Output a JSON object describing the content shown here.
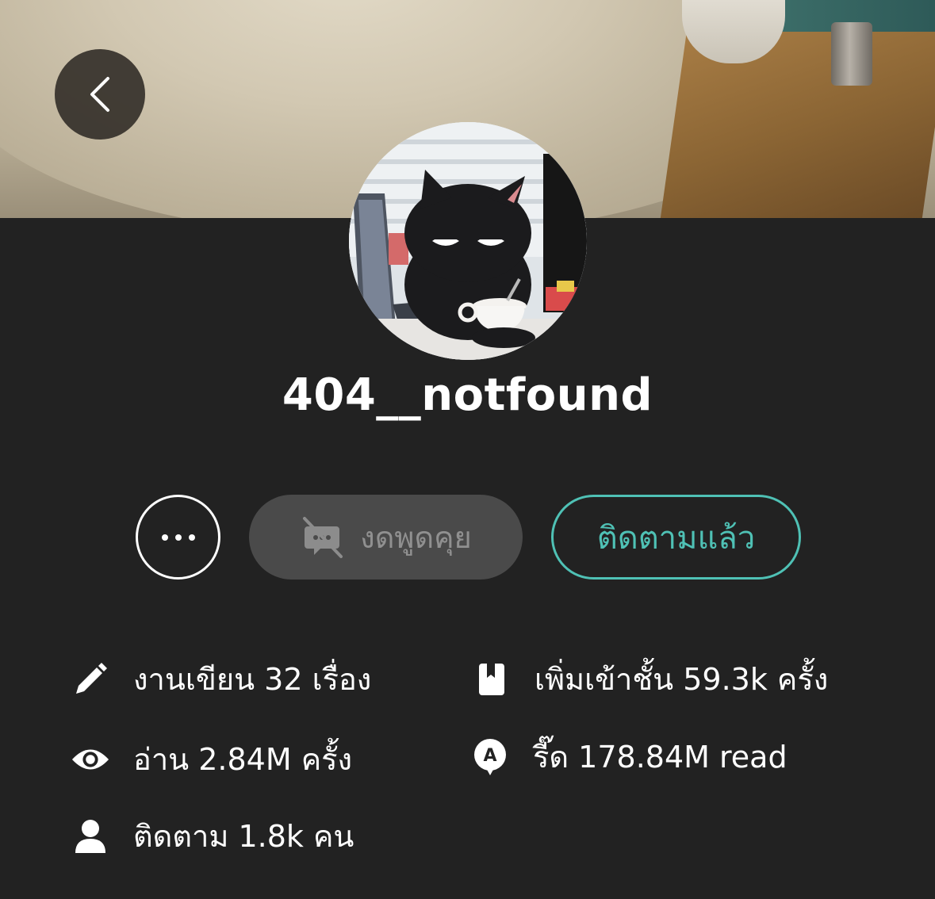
{
  "profile": {
    "username": "404__notfound"
  },
  "actions": {
    "chat_label": "งดพูดคุย",
    "follow_label": "ติดตามแล้ว"
  },
  "stats": {
    "works": "งานเขียน 32 เรื่อง",
    "shelf_adds": "เพิ่มเข้าชั้น 59.3k ครั้ง",
    "reads": "อ่าน 2.84M ครั้ง",
    "read_alt": "รี๊ด 178.84M read",
    "followers": "ติดตาม 1.8k คน"
  },
  "icons": {
    "back": "chevron-left-icon",
    "more": "more-dots-icon",
    "chat": "chat-off-icon",
    "works": "pencil-icon",
    "shelf": "bookmark-icon",
    "reads": "eye-icon",
    "read_alt": "read-badge-icon",
    "followers": "person-icon"
  },
  "colors": {
    "background": "#222222",
    "accent": "#4fc1b5",
    "disabled_button": "#4a4a4a",
    "disabled_text": "#909090"
  }
}
